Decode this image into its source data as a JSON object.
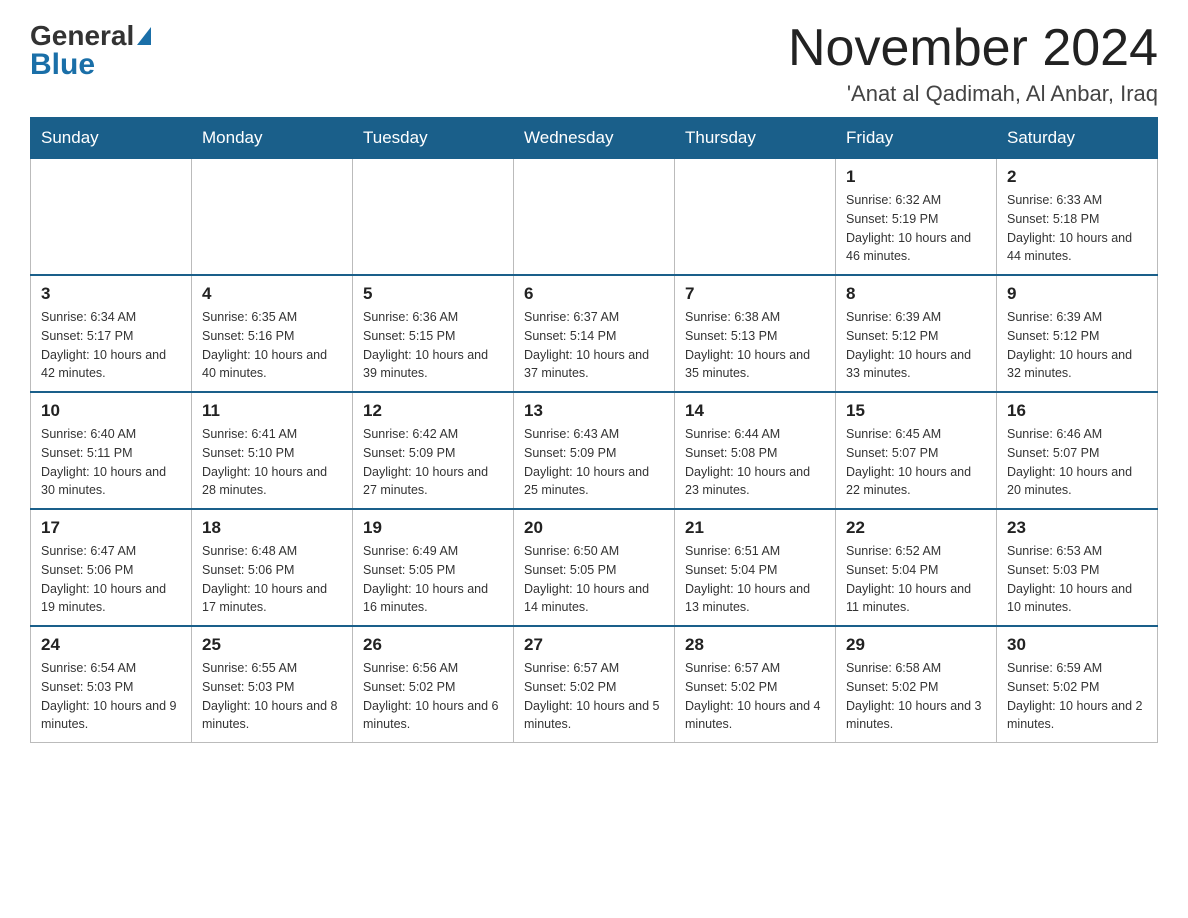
{
  "header": {
    "logo": {
      "general": "General",
      "blue": "Blue"
    },
    "title": "November 2024",
    "location": "'Anat al Qadimah, Al Anbar, Iraq"
  },
  "days_of_week": [
    "Sunday",
    "Monday",
    "Tuesday",
    "Wednesday",
    "Thursday",
    "Friday",
    "Saturday"
  ],
  "weeks": [
    [
      {
        "day": "",
        "info": ""
      },
      {
        "day": "",
        "info": ""
      },
      {
        "day": "",
        "info": ""
      },
      {
        "day": "",
        "info": ""
      },
      {
        "day": "",
        "info": ""
      },
      {
        "day": "1",
        "info": "Sunrise: 6:32 AM\nSunset: 5:19 PM\nDaylight: 10 hours and 46 minutes."
      },
      {
        "day": "2",
        "info": "Sunrise: 6:33 AM\nSunset: 5:18 PM\nDaylight: 10 hours and 44 minutes."
      }
    ],
    [
      {
        "day": "3",
        "info": "Sunrise: 6:34 AM\nSunset: 5:17 PM\nDaylight: 10 hours and 42 minutes."
      },
      {
        "day": "4",
        "info": "Sunrise: 6:35 AM\nSunset: 5:16 PM\nDaylight: 10 hours and 40 minutes."
      },
      {
        "day": "5",
        "info": "Sunrise: 6:36 AM\nSunset: 5:15 PM\nDaylight: 10 hours and 39 minutes."
      },
      {
        "day": "6",
        "info": "Sunrise: 6:37 AM\nSunset: 5:14 PM\nDaylight: 10 hours and 37 minutes."
      },
      {
        "day": "7",
        "info": "Sunrise: 6:38 AM\nSunset: 5:13 PM\nDaylight: 10 hours and 35 minutes."
      },
      {
        "day": "8",
        "info": "Sunrise: 6:39 AM\nSunset: 5:12 PM\nDaylight: 10 hours and 33 minutes."
      },
      {
        "day": "9",
        "info": "Sunrise: 6:39 AM\nSunset: 5:12 PM\nDaylight: 10 hours and 32 minutes."
      }
    ],
    [
      {
        "day": "10",
        "info": "Sunrise: 6:40 AM\nSunset: 5:11 PM\nDaylight: 10 hours and 30 minutes."
      },
      {
        "day": "11",
        "info": "Sunrise: 6:41 AM\nSunset: 5:10 PM\nDaylight: 10 hours and 28 minutes."
      },
      {
        "day": "12",
        "info": "Sunrise: 6:42 AM\nSunset: 5:09 PM\nDaylight: 10 hours and 27 minutes."
      },
      {
        "day": "13",
        "info": "Sunrise: 6:43 AM\nSunset: 5:09 PM\nDaylight: 10 hours and 25 minutes."
      },
      {
        "day": "14",
        "info": "Sunrise: 6:44 AM\nSunset: 5:08 PM\nDaylight: 10 hours and 23 minutes."
      },
      {
        "day": "15",
        "info": "Sunrise: 6:45 AM\nSunset: 5:07 PM\nDaylight: 10 hours and 22 minutes."
      },
      {
        "day": "16",
        "info": "Sunrise: 6:46 AM\nSunset: 5:07 PM\nDaylight: 10 hours and 20 minutes."
      }
    ],
    [
      {
        "day": "17",
        "info": "Sunrise: 6:47 AM\nSunset: 5:06 PM\nDaylight: 10 hours and 19 minutes."
      },
      {
        "day": "18",
        "info": "Sunrise: 6:48 AM\nSunset: 5:06 PM\nDaylight: 10 hours and 17 minutes."
      },
      {
        "day": "19",
        "info": "Sunrise: 6:49 AM\nSunset: 5:05 PM\nDaylight: 10 hours and 16 minutes."
      },
      {
        "day": "20",
        "info": "Sunrise: 6:50 AM\nSunset: 5:05 PM\nDaylight: 10 hours and 14 minutes."
      },
      {
        "day": "21",
        "info": "Sunrise: 6:51 AM\nSunset: 5:04 PM\nDaylight: 10 hours and 13 minutes."
      },
      {
        "day": "22",
        "info": "Sunrise: 6:52 AM\nSunset: 5:04 PM\nDaylight: 10 hours and 11 minutes."
      },
      {
        "day": "23",
        "info": "Sunrise: 6:53 AM\nSunset: 5:03 PM\nDaylight: 10 hours and 10 minutes."
      }
    ],
    [
      {
        "day": "24",
        "info": "Sunrise: 6:54 AM\nSunset: 5:03 PM\nDaylight: 10 hours and 9 minutes."
      },
      {
        "day": "25",
        "info": "Sunrise: 6:55 AM\nSunset: 5:03 PM\nDaylight: 10 hours and 8 minutes."
      },
      {
        "day": "26",
        "info": "Sunrise: 6:56 AM\nSunset: 5:02 PM\nDaylight: 10 hours and 6 minutes."
      },
      {
        "day": "27",
        "info": "Sunrise: 6:57 AM\nSunset: 5:02 PM\nDaylight: 10 hours and 5 minutes."
      },
      {
        "day": "28",
        "info": "Sunrise: 6:57 AM\nSunset: 5:02 PM\nDaylight: 10 hours and 4 minutes."
      },
      {
        "day": "29",
        "info": "Sunrise: 6:58 AM\nSunset: 5:02 PM\nDaylight: 10 hours and 3 minutes."
      },
      {
        "day": "30",
        "info": "Sunrise: 6:59 AM\nSunset: 5:02 PM\nDaylight: 10 hours and 2 minutes."
      }
    ]
  ]
}
